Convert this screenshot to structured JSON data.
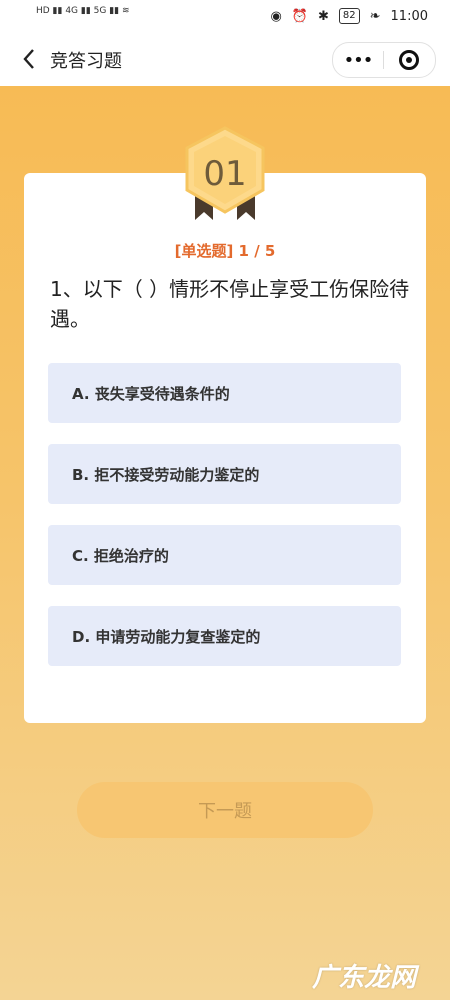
{
  "status_bar": {
    "time": "11:00",
    "battery": "82",
    "left_icons": [
      "HD",
      "4G",
      "5G",
      "wifi-icon"
    ],
    "right_icons": [
      "eye-icon",
      "alarm-icon",
      "bluetooth-icon",
      "leaf-icon"
    ]
  },
  "nav": {
    "title": "竞答习题",
    "more_label": "•••"
  },
  "quiz": {
    "badge_number": "01",
    "question_type": "[单选题] 1 / 5",
    "question_text": "1、以下（ ）情形不停止享受工伤保险待遇。",
    "options": [
      {
        "label": "A. 丧失享受待遇条件的"
      },
      {
        "label": "B. 拒不接受劳动能力鉴定的"
      },
      {
        "label": "C. 拒绝治疗的"
      },
      {
        "label": "D. 申请劳动能力复查鉴定的"
      }
    ],
    "next_button": "下一题"
  },
  "watermark": "广东龙网",
  "colors": {
    "accent": "#e36a2d",
    "option_bg": "#e6ebf9",
    "background": "#f6c46a"
  }
}
